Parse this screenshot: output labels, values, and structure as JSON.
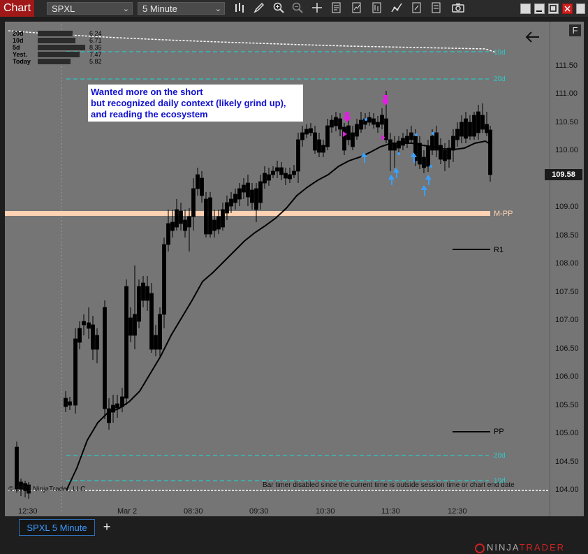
{
  "toolbar": {
    "chart_tab": "Chart",
    "instrument": "SPXL",
    "timeframe": "5 Minute",
    "tools": [
      "bars-icon",
      "draw-pencil-icon",
      "zoom-in-icon",
      "zoom-out-icon",
      "crosshair-icon",
      "properties-icon",
      "strategy-icon",
      "indicators-icon",
      "drawing-tools-icon",
      "templates-icon",
      "screenshot-icon"
    ]
  },
  "chart": {
    "f_button": "F",
    "annotation": [
      "Wanted more on the short",
      "but recognized daily context (likely grind up),",
      "and reading the ecosystem"
    ],
    "range_panel": [
      {
        "label": "20d",
        "value": "6.24"
      },
      {
        "label": "10d",
        "value": "6.71"
      },
      {
        "label": "5d",
        "value": "8.35"
      },
      {
        "label": "Yest.",
        "value": "7.47"
      },
      {
        "label": "Today",
        "value": "5.82"
      }
    ],
    "level_labels": {
      "m_pp": "M-PP",
      "r1": "R1",
      "pp": "PP",
      "avg20_top": "20d",
      "avg20_bottom": "20d",
      "avg10_top": "10d",
      "avg10_bottom": "10d"
    },
    "copyright": "© 2022 NinjaTrader, LLC",
    "bar_timer": "Bar timer disabled since the current time is outside session time or chart end date",
    "price_labels": [
      "111.50",
      "111.00",
      "110.50",
      "110.00",
      "109.50",
      "109.00",
      "108.50",
      "108.00",
      "107.50",
      "107.00",
      "106.50",
      "106.00",
      "105.50",
      "105.00",
      "104.50",
      "104.00"
    ],
    "current_price": "109.58",
    "time_labels": [
      "12:30",
      "Mar 2",
      "08:30",
      "09:30",
      "10:30",
      "11:30",
      "12:30"
    ],
    "colors": {
      "background": "#757575",
      "up_candle": "#ffffff",
      "down_candle": "#000000",
      "moving_average": "#000000",
      "teal_line": "#2ec8c8",
      "mpp_band": "#ffd2b3",
      "annotation_text": "#1010d0",
      "magenta_marker": "#e020e0",
      "blue_marker": "#3aa0ff"
    }
  },
  "tab": {
    "label": "SPXL 5 Minute",
    "add": "+"
  },
  "branding": {
    "ninja": "NINJA",
    "trader": "TRADER"
  }
}
